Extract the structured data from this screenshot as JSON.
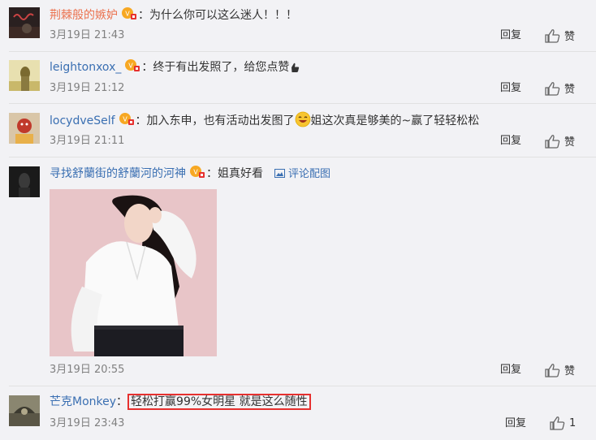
{
  "comments": [
    {
      "user": "荆棘般的嫉妒",
      "separator": "：",
      "text": "为什么你可以这么迷人！！！",
      "time": "3月19日 21:43",
      "reply": "回复",
      "like": "赞"
    },
    {
      "user": "leightonxox_",
      "separator": "：",
      "text": "终于有出发照了，给您点赞",
      "time": "3月19日 21:12",
      "reply": "回复",
      "like": "赞"
    },
    {
      "user": "locydveSelf",
      "separator": "：",
      "text_a": "加入东申，也有活动出发图了",
      "text_b": "姐这次真是够美的~赢了轻轻松松",
      "time": "3月19日 21:11",
      "reply": "回复",
      "like": "赞"
    },
    {
      "user": "寻找舒蘭街的舒蘭河的河神",
      "separator": "：",
      "text": "姐真好看",
      "pic_link": "评论配图",
      "time": "3月19日 20:55",
      "reply": "回复",
      "like": "赞"
    },
    {
      "user": "芒克Monkey",
      "separator": "：",
      "text": "轻松打赢99%女明星 就是这么随性",
      "time": "3月19日 23:43",
      "reply": "回复",
      "like_count": "1"
    }
  ],
  "colors": {
    "username_orange": "#eb7350",
    "username_blue": "#3a6fb2",
    "highlight": "#e6302f"
  }
}
